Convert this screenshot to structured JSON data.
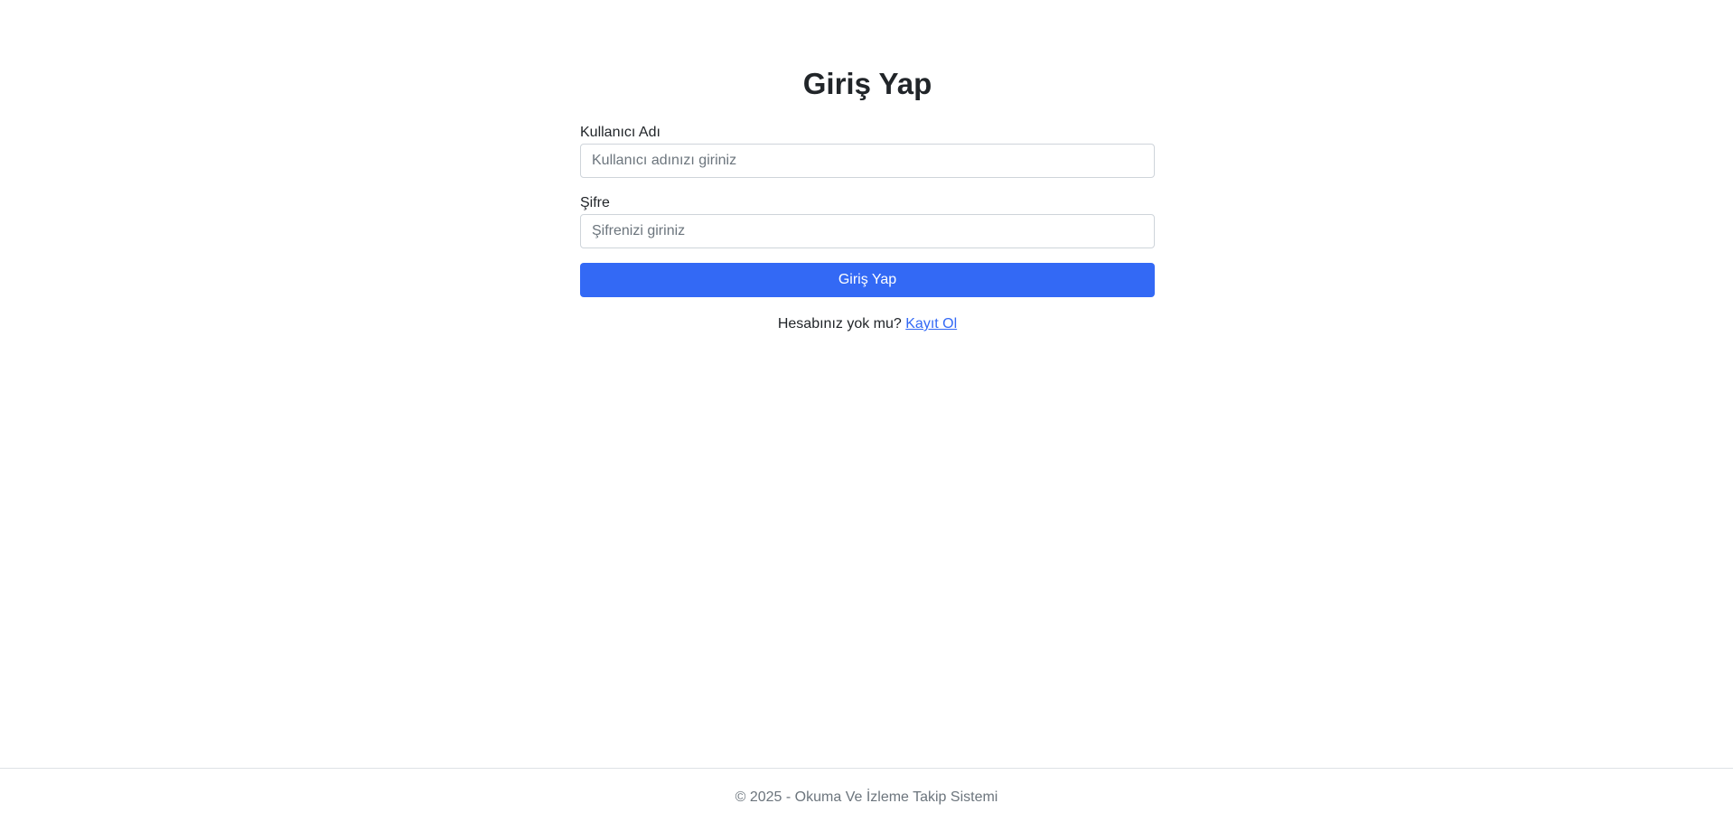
{
  "login": {
    "title": "Giriş Yap",
    "username_label": "Kullanıcı Adı",
    "username_placeholder": "Kullanıcı adınızı giriniz",
    "username_value": "",
    "password_label": "Şifre",
    "password_placeholder": "Şifrenizi giriniz",
    "password_value": "",
    "submit_label": "Giriş Yap",
    "register_prompt": "Hesabınız yok mu?",
    "register_link": "Kayıt Ol"
  },
  "footer": {
    "text": "© 2025 - Okuma Ve İzleme Takip Sistemi"
  },
  "colors": {
    "primary": "#3369f5",
    "text": "#212529",
    "muted": "#6c757d",
    "border": "#ced4da"
  }
}
